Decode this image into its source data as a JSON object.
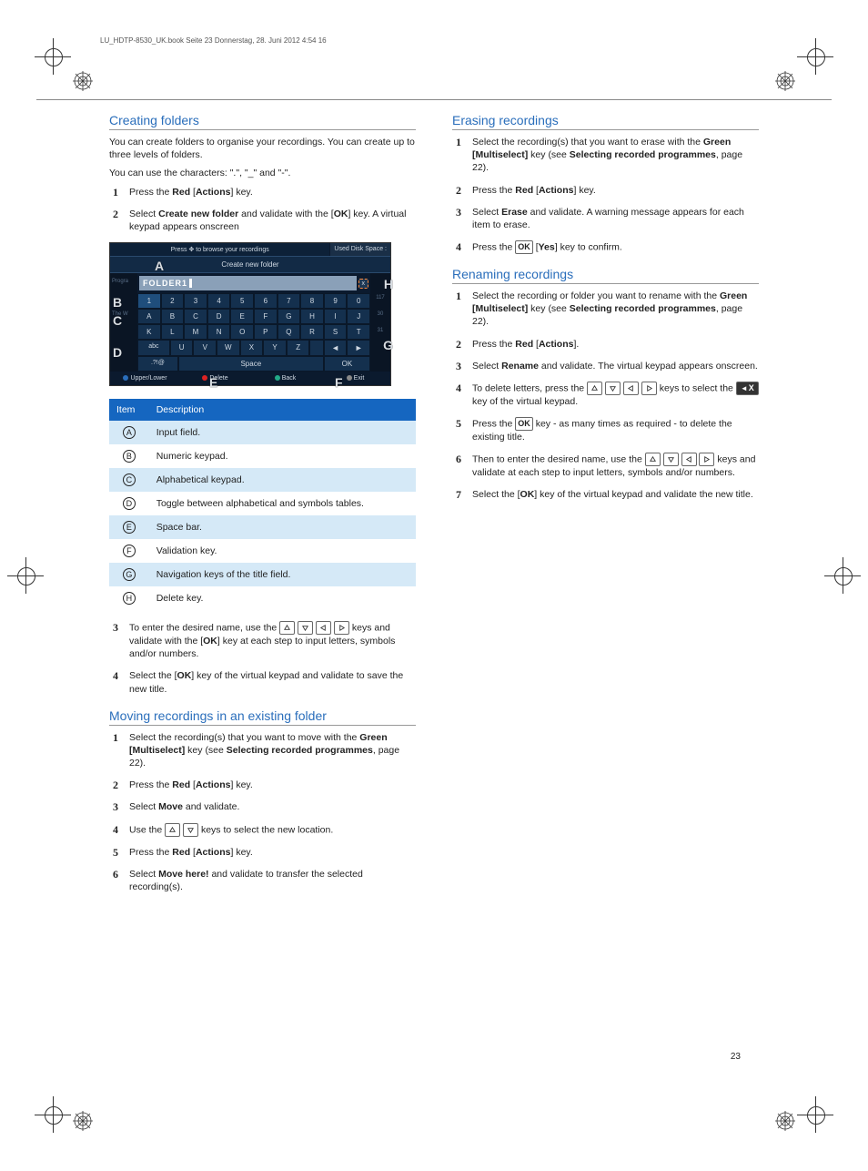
{
  "header": "LU_HDTP-8530_UK.book  Seite 23  Donnerstag, 28. Juni 2012  4:54 16",
  "page_number": "23",
  "left": {
    "sec1": {
      "title": "Creating folders",
      "p1": "You can create folders to organise your recordings. You can create up to three levels of folders.",
      "p2": "You can use the characters: \".\", \"_\" and \"-\".",
      "step1a": "Press the ",
      "step1b": "Red",
      "step1c": " [",
      "step1d": "Actions",
      "step1e": "] key.",
      "step2a": "Select ",
      "step2b": "Create new folder",
      "step2c": " and validate with the [",
      "step2d": "OK",
      "step2e": "] key. A virtual keypad appears onscreen",
      "step3a": "To enter the desired name, use the ",
      "step3b": " keys and validate with the [",
      "step3c": "OK",
      "step3d": "] key at each step to input letters, symbols and/or numbers.",
      "step4a": "Select the [",
      "step4b": "OK",
      "step4c": "] key of the virtual keypad and validate to save the new title."
    },
    "keypad": {
      "browse": "Press ✥ to browse your recordings",
      "disk": "Used Disk Space :",
      "title": "Create new folder",
      "side": [
        "Progra",
        "",
        "The W",
        ""
      ],
      "sideR": [
        "",
        "117",
        "30",
        "31"
      ],
      "input": "FOLDER1",
      "del": "x",
      "row1": [
        "1",
        "2",
        "3",
        "4",
        "5",
        "6",
        "7",
        "8",
        "9",
        "0"
      ],
      "row2": [
        "A",
        "B",
        "C",
        "D",
        "E",
        "F",
        "G",
        "H",
        "I",
        "J"
      ],
      "row3": [
        "K",
        "L",
        "M",
        "N",
        "O",
        "P",
        "Q",
        "R",
        "S",
        "T"
      ],
      "row4": [
        "abc",
        "U",
        "V",
        "W",
        "X",
        "Y",
        "Z",
        "",
        "◄",
        "►"
      ],
      "row5l": ".?!@",
      "row5c": "Space",
      "row5r": "OK",
      "bottom": {
        "upper": "Upper/Lower",
        "delete": "Delete",
        "back": "Back",
        "exit": "Exit"
      },
      "labels": {
        "A": "A",
        "B": "B",
        "C": "C",
        "D": "D",
        "E": "E",
        "F": "F",
        "G": "G",
        "H": "H"
      }
    },
    "table": {
      "h1": "Item",
      "h2": "Description",
      "rows": [
        {
          "k": "A",
          "d": "Input field."
        },
        {
          "k": "B",
          "d": "Numeric keypad."
        },
        {
          "k": "C",
          "d": "Alphabetical keypad."
        },
        {
          "k": "D",
          "d": "Toggle between alphabetical and symbols tables."
        },
        {
          "k": "E",
          "d": "Space bar."
        },
        {
          "k": "F",
          "d": "Validation key."
        },
        {
          "k": "G",
          "d": "Navigation keys of the title field."
        },
        {
          "k": "H",
          "d": "Delete key."
        }
      ]
    },
    "sec2": {
      "title": "Moving recordings in an existing folder",
      "s1a": "Select the recording(s) that you want to move with the ",
      "s1b": "Green [Multiselect]",
      "s1c": " key (see ",
      "s1d": "Selecting recorded programmes",
      "s1e": ", page 22).",
      "s2a": "Press the ",
      "s2b": "Red",
      "s2c": " [",
      "s2d": "Actions",
      "s2e": "] key.",
      "s3a": "Select ",
      "s3b": "Move",
      "s3c": " and validate.",
      "s4a": "Use the ",
      "s4b": " keys to select the new location.",
      "s5a": "Press the ",
      "s5b": "Red",
      "s5c": " [",
      "s5d": "Actions",
      "s5e": "] key.",
      "s6a": "Select ",
      "s6b": "Move here!",
      "s6c": " and validate to transfer the selected recording(s)."
    }
  },
  "right": {
    "sec1": {
      "title": "Erasing recordings",
      "s1a": "Select the recording(s) that you want to erase with the ",
      "s1b": "Green [Multiselect]",
      "s1c": " key (see ",
      "s1d": "Selecting recorded programmes",
      "s1e": ", page 22).",
      "s2a": "Press the ",
      "s2b": "Red",
      "s2c": " [",
      "s2d": "Actions",
      "s2e": "] key.",
      "s3a": "Select ",
      "s3b": "Erase",
      "s3c": " and validate. A warning message appears for each item to erase.",
      "s4a": "Press the ",
      "s4b": " [",
      "s4c": "Yes",
      "s4d": "] key to confirm."
    },
    "sec2": {
      "title": "Renaming recordings",
      "s1a": "Select the recording or folder you want to rename with the ",
      "s1b": "Green [Multiselect]",
      "s1c": " key (see ",
      "s1d": "Selecting recorded programmes",
      "s1e": ", page 22).",
      "s2a": "Press the ",
      "s2b": "Red",
      "s2c": " [",
      "s2d": "Actions",
      "s2e": "].",
      "s3a": "Select ",
      "s3b": "Rename",
      "s3c": " and validate. The virtual keypad appears onscreen.",
      "s4a": "To delete letters, press the ",
      "s4b": " keys to select the ",
      "s4c": " key of the virtual keypad.",
      "s5a": "Press the ",
      "s5b": " key - as many times as required - to delete the existing title.",
      "s6a": "Then to enter the desired name, use the ",
      "s6b": " keys and validate at each step to input letters, symbols and/or numbers.",
      "s7a": "Select the [",
      "s7b": "OK",
      "s7c": "] key of the virtual keypad and validate the new title."
    }
  }
}
